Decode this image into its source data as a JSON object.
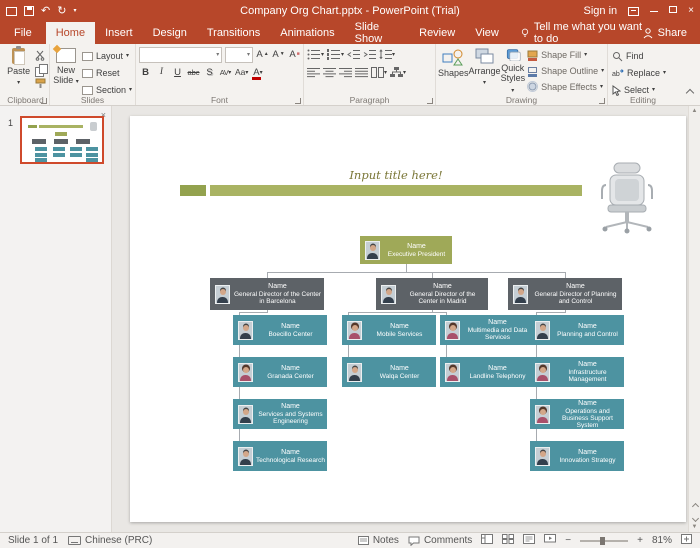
{
  "colors": {
    "accent": "#b7472a",
    "olive_box": "#9fa958",
    "olive_bar_short": "#93a24e",
    "olive_bar_long": "#a9b363",
    "director_gray": "#5d6267",
    "teal_box": "#4d93a1"
  },
  "window": {
    "title": "Company Org Chart.pptx - PowerPoint (Trial)",
    "sign_in": "Sign in"
  },
  "ribbon": {
    "tabs": [
      "File",
      "Home",
      "Insert",
      "Design",
      "Transitions",
      "Animations",
      "Slide Show",
      "Review",
      "View"
    ],
    "tell_me": "Tell me what you want to do",
    "share": "Share",
    "clipboard": {
      "label": "Clipboard",
      "paste": "Paste"
    },
    "slides": {
      "label": "Slides",
      "new_slide": "New Slide",
      "layout": "Layout",
      "reset": "Reset",
      "section": "Section"
    },
    "font": {
      "label": "Font",
      "bold": "B",
      "italic": "I",
      "underline": "U",
      "strike": "abc",
      "shadow": "S",
      "spacing": "AV",
      "case": "Aa",
      "color": "A",
      "grow": "A",
      "shrink": "A"
    },
    "paragraph": {
      "label": "Paragraph"
    },
    "drawing": {
      "label": "Drawing",
      "shapes": "Shapes",
      "arrange": "Arrange",
      "quick_styles": "Quick Styles",
      "fill": "Shape Fill",
      "outline": "Shape Outline",
      "effects": "Shape Effects"
    },
    "editing": {
      "label": "Editing",
      "find": "Find",
      "replace": "Replace",
      "select": "Select"
    }
  },
  "thumbnail_panel": {
    "slide_number": "1"
  },
  "slide": {
    "title": "Input title here!",
    "org": {
      "exec": {
        "name": "Name",
        "title": "Executive President",
        "avatar": "male"
      },
      "directors": [
        {
          "name": "Name",
          "title": "General Director of the Center in Barcelona",
          "avatar": "male"
        },
        {
          "name": "Name",
          "title": "General Director of the Center in Madrid",
          "avatar": "male"
        },
        {
          "name": "Name",
          "title": "General Director of Planning and Control",
          "avatar": "male"
        }
      ],
      "cols": [
        {
          "items": [
            {
              "name": "Name",
              "title": "Boecillo Center",
              "avatar": "male"
            },
            {
              "name": "Name",
              "title": "Granada Center",
              "avatar": "female"
            },
            {
              "name": "Name",
              "title": "Services and Systems Engineering",
              "avatar": "male"
            },
            {
              "name": "Name",
              "title": "Technological Research",
              "avatar": "male"
            }
          ]
        },
        {
          "items": [
            {
              "name": "Name",
              "title": "Mobile Services",
              "avatar": "female"
            },
            {
              "name": "Name",
              "title": "Walqa Center",
              "avatar": "male"
            }
          ]
        },
        {
          "items": [
            {
              "name": "Name",
              "title": "Multimedia and Data Services",
              "avatar": "female"
            },
            {
              "name": "Name",
              "title": "Landline Telephony",
              "avatar": "female"
            }
          ]
        },
        {
          "items": [
            {
              "name": "Name",
              "title": "Planning and Control",
              "avatar": "male"
            },
            {
              "name": "Name",
              "title": "Infrastructure Management",
              "avatar": "female"
            },
            {
              "name": "Name",
              "title": "Operations and Business Support System",
              "avatar": "female"
            },
            {
              "name": "Name",
              "title": "Innovation Strategy",
              "avatar": "male"
            }
          ]
        }
      ]
    }
  },
  "status": {
    "slide_indicator": "Slide 1 of 1",
    "language": "Chinese (PRC)",
    "notes": "Notes",
    "comments": "Comments",
    "zoom": "81%"
  }
}
